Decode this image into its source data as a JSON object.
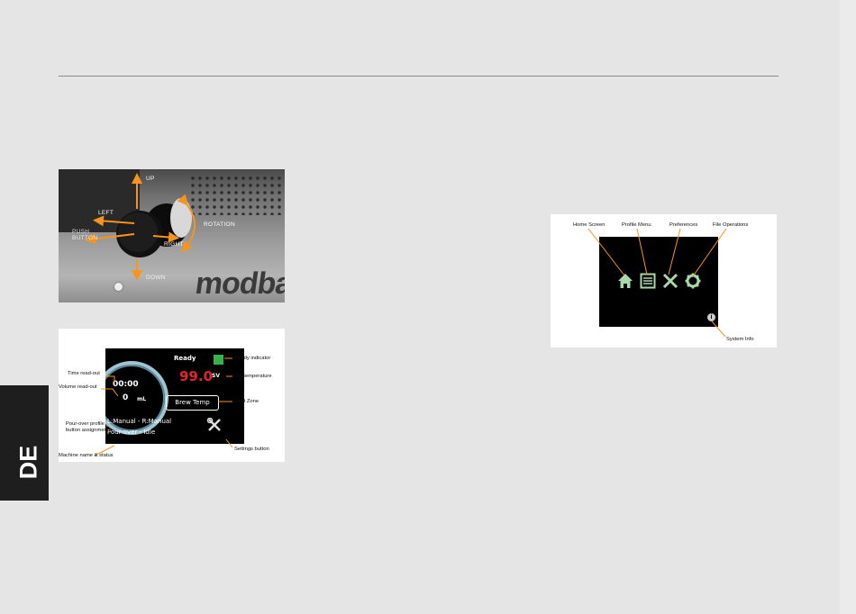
{
  "page": {
    "language_tab": "DE"
  },
  "knob_photo": {
    "labels": {
      "up": "UP",
      "left": "LEFT",
      "push_button": "PUSH\nBUTTON",
      "right": "RIGHT",
      "rotation": "ROTATION",
      "down": "DOWN"
    },
    "brand_text": "modba",
    "colors": {
      "arrow": "#f7941d"
    }
  },
  "home_display": {
    "screen": {
      "status": "Ready",
      "time": "00:00",
      "volume_value": "0",
      "volume_unit": "mL",
      "set_temperature": "99.0",
      "set_temperature_suffix": "SV",
      "heat_zone_button": "Brew Temp",
      "button_assignments": "L:Manual - R:Manual",
      "machine_status": "Pour-over - Idle"
    },
    "annotations": {
      "time_readout": "Time read-out",
      "volume_readout": "Volume read-out",
      "pour_over_profile": "Pour-over profile\nbutton assignments",
      "machine_name_status": "Machine name & status",
      "ready_indicator": "Ready indicator",
      "set_temperature": "Set temperature",
      "heat_zone": "Heat Zone",
      "settings_button": "Settings button"
    },
    "colors": {
      "ready": "#35b249",
      "temperature": "#e0262b",
      "callout": "#f7941d"
    }
  },
  "menu_display": {
    "annotations": {
      "home_screen": "Home Screen",
      "profile_menu": "Profile Menu",
      "preferences": "Preferences",
      "file_operations": "File Operations",
      "system_info": "System Info"
    },
    "icons": [
      "home-icon",
      "profile-menu-icon",
      "tools-icon",
      "gear-icon",
      "info-icon"
    ],
    "colors": {
      "icon": "#a9d9a9"
    }
  }
}
